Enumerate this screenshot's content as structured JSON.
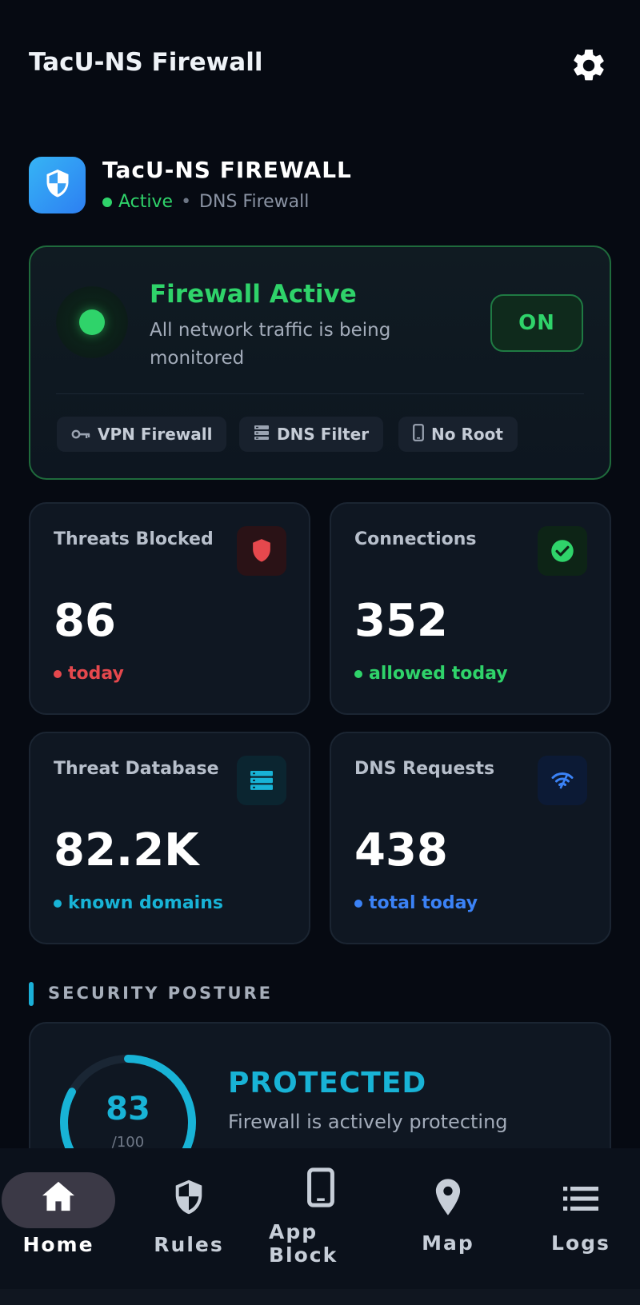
{
  "app_bar": {
    "title": "TacU-NS Firewall",
    "settings_icon": "gear-icon"
  },
  "brand": {
    "icon": "shield-icon",
    "name": "TacU-NS FIREWALL",
    "status": "Active",
    "separator": "•",
    "type": "DNS Firewall"
  },
  "firewall": {
    "title": "Firewall Active",
    "description": "All network traffic is being monitored",
    "toggle_label": "ON",
    "chips": [
      {
        "icon": "key-icon",
        "label": "VPN Firewall"
      },
      {
        "icon": "server-icon",
        "label": "DNS Filter"
      },
      {
        "icon": "phone-icon",
        "label": "No Root"
      }
    ]
  },
  "stats": [
    {
      "label": "Threats Blocked",
      "value": "86",
      "sub": "today",
      "icon": "shield-icon",
      "color": "#e5484d"
    },
    {
      "label": "Connections",
      "value": "352",
      "sub": "allowed today",
      "icon": "check-circle-icon",
      "color": "#2fd36a"
    },
    {
      "label": "Threat Database",
      "value": "82.2K",
      "sub": "known domains",
      "icon": "database-icon",
      "color": "#18b3d6"
    },
    {
      "label": "DNS Requests",
      "value": "438",
      "sub": "total today",
      "icon": "wifi-icon",
      "color": "#3b82f6"
    }
  ],
  "posture": {
    "section_title": "SECURITY POSTURE",
    "score": "83",
    "score_max": "/100",
    "score_fraction": 0.83,
    "status": "PROTECTED",
    "description": "Firewall is actively protecting"
  },
  "nav": {
    "items": [
      {
        "label": "Home",
        "icon": "home-icon",
        "active": true
      },
      {
        "label": "Rules",
        "icon": "shield-icon",
        "active": false
      },
      {
        "label": "App\nBlock",
        "icon": "phone-icon",
        "active": false
      },
      {
        "label": "Map",
        "icon": "map-pin-icon",
        "active": false
      },
      {
        "label": "Logs",
        "icon": "list-icon",
        "active": false
      }
    ]
  },
  "colors": {
    "accent_green": "#2fd36a",
    "accent_cyan": "#18b3d6",
    "accent_red": "#e5484d",
    "accent_blue": "#3b82f6",
    "background": "#060a12"
  }
}
